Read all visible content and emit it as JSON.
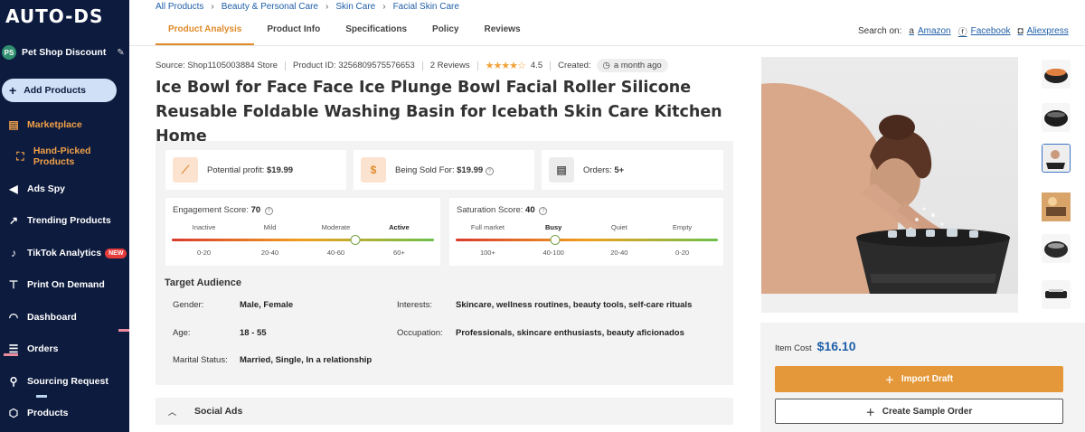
{
  "app": {
    "logo": "AUTO-DS"
  },
  "sidebar": {
    "store_initials": "PS",
    "store_name": "Pet Shop Discount",
    "add_products": "Add Products",
    "items": [
      {
        "label": "Marketplace",
        "icon": "store-icon"
      },
      {
        "label": "Hand-Picked Products",
        "icon": "handpicked-icon"
      },
      {
        "label": "Ads Spy",
        "icon": "megaphone-icon"
      },
      {
        "label": "Trending Products",
        "icon": "trend-chart-icon"
      },
      {
        "label": "TikTok Analytics",
        "icon": "tiktok-icon",
        "badge": "NEW"
      },
      {
        "label": "Print On Demand",
        "icon": "shirt-icon"
      },
      {
        "label": "Dashboard",
        "icon": "gauge-icon"
      },
      {
        "label": "Orders",
        "icon": "orders-icon"
      },
      {
        "label": "Sourcing Request",
        "icon": "sourcing-icon"
      },
      {
        "label": "Products",
        "icon": "box-icon"
      }
    ]
  },
  "breadcrumbs": [
    "All Products",
    "Beauty & Personal Care",
    "Skin Care",
    "Facial Skin Care"
  ],
  "tabs": [
    "Product Analysis",
    "Product Info",
    "Specifications",
    "Policy",
    "Reviews"
  ],
  "search_on": {
    "label": "Search on:",
    "links": [
      "Amazon",
      "Facebook",
      "Aliexpress"
    ]
  },
  "meta": {
    "source": "Source: Shop1105003884 Store",
    "product_id": "Product ID: 3256809575576653",
    "reviews": "2 Reviews",
    "rating": "4.5",
    "created_label": "Created:",
    "created_value": "a month ago"
  },
  "title": "Ice Bowl for Face Face Ice Plunge Bowl Facial Roller Silicone Reusable Foldable Washing Basin for Icebath Skin Care Kitchen Home",
  "stats": {
    "profit_label": "Potential profit:",
    "profit_value": "$19.99",
    "sold_label": "Being Sold For:",
    "sold_value": "$19.99",
    "orders_label": "Orders:",
    "orders_value": "5+"
  },
  "engagement": {
    "label": "Engagement Score:",
    "value": "70",
    "levels": [
      "Inactive",
      "Mild",
      "Moderate",
      "Active"
    ],
    "ranges": [
      "0-20",
      "20-40",
      "40-60",
      "60+"
    ],
    "level_fraction": 0.7
  },
  "saturation": {
    "label": "Saturation Score:",
    "value": "40",
    "levels": [
      "Full market",
      "Busy",
      "Quiet",
      "Empty"
    ],
    "ranges": [
      "100+",
      "40-100",
      "20-40",
      "0-20"
    ],
    "level_fraction": 0.38
  },
  "audience": {
    "title": "Target Audience",
    "gender_label": "Gender:",
    "gender": "Male, Female",
    "age_label": "Age:",
    "age": "18 - 55",
    "marital_label": "Marital Status:",
    "marital": "Married, Single, In a relationship",
    "interests_label": "Interests:",
    "interests": "Skincare, wellness routines, beauty tools, self-care rituals",
    "occupation_label": "Occupation:",
    "occupation": "Professionals, skincare enthusiasts, beauty aficionados"
  },
  "social_ads": "Social Ads",
  "buy": {
    "item_cost_label": "Item Cost",
    "item_cost": "$16.10",
    "import_label": "Import Draft",
    "sample_label": "Create Sample Order"
  },
  "colors": {
    "accent": "#e59839",
    "link": "#1f5fa8",
    "sidebar": "#0d1b3e"
  }
}
